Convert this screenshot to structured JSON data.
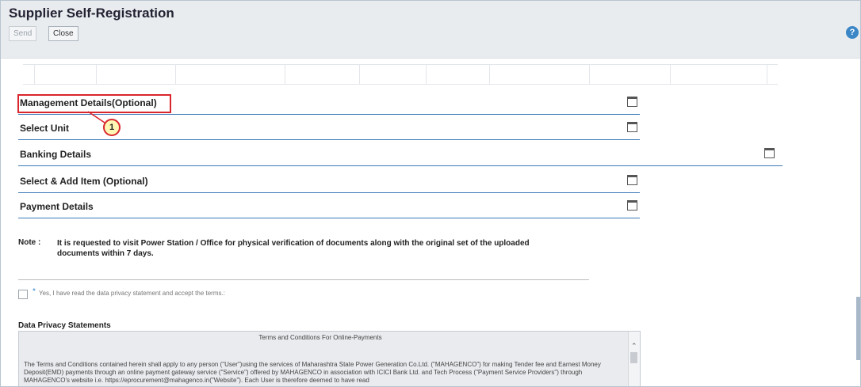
{
  "window": {
    "title": "Supplier Self-Registration"
  },
  "toolbar": {
    "send_label": "Send",
    "close_label": "Close",
    "help_glyph": "?"
  },
  "sections": [
    {
      "label": "Management Details(Optional)"
    },
    {
      "label": "Select Unit"
    },
    {
      "label": "Banking Details"
    },
    {
      "label": "Select & Add Item (Optional)"
    },
    {
      "label": "Payment Details"
    }
  ],
  "callout": {
    "number": "1",
    "color": "#d9262c"
  },
  "note": {
    "label": "Note :",
    "text": "It is requested to visit Power Station / Office for physical verification of documents along with the original set of the uploaded documents within 7 days."
  },
  "privacy": {
    "required_mark": "*",
    "checkbox_label": "Yes, I have read the data privacy statement and accept the terms.:",
    "title": "Data Privacy Statements",
    "box_heading": "Terms and Conditions For Online-Payments",
    "box_text": "The Terms and Conditions contained herein shall apply to any person (\"User\")using the services of Maharashtra State Power Generation Co.Ltd. (\"MAHAGENCO\") for making Tender fee and Earnest Money Deposit(EMD) payments through an online payment gateway service (\"Service\") offered by MAHAGENCO in association with ICICI Bank Ltd. and Tech Process (\"Payment Service Providers\") through MAHAGENCO's website i.e. https://eprocurement@mahagenco.in(\"Website\"). Each User is therefore deemed to have read"
  },
  "colors": {
    "accent": "#3d7ab8",
    "highlight": "#d9262c",
    "callout_fill": "#fff8b5"
  }
}
